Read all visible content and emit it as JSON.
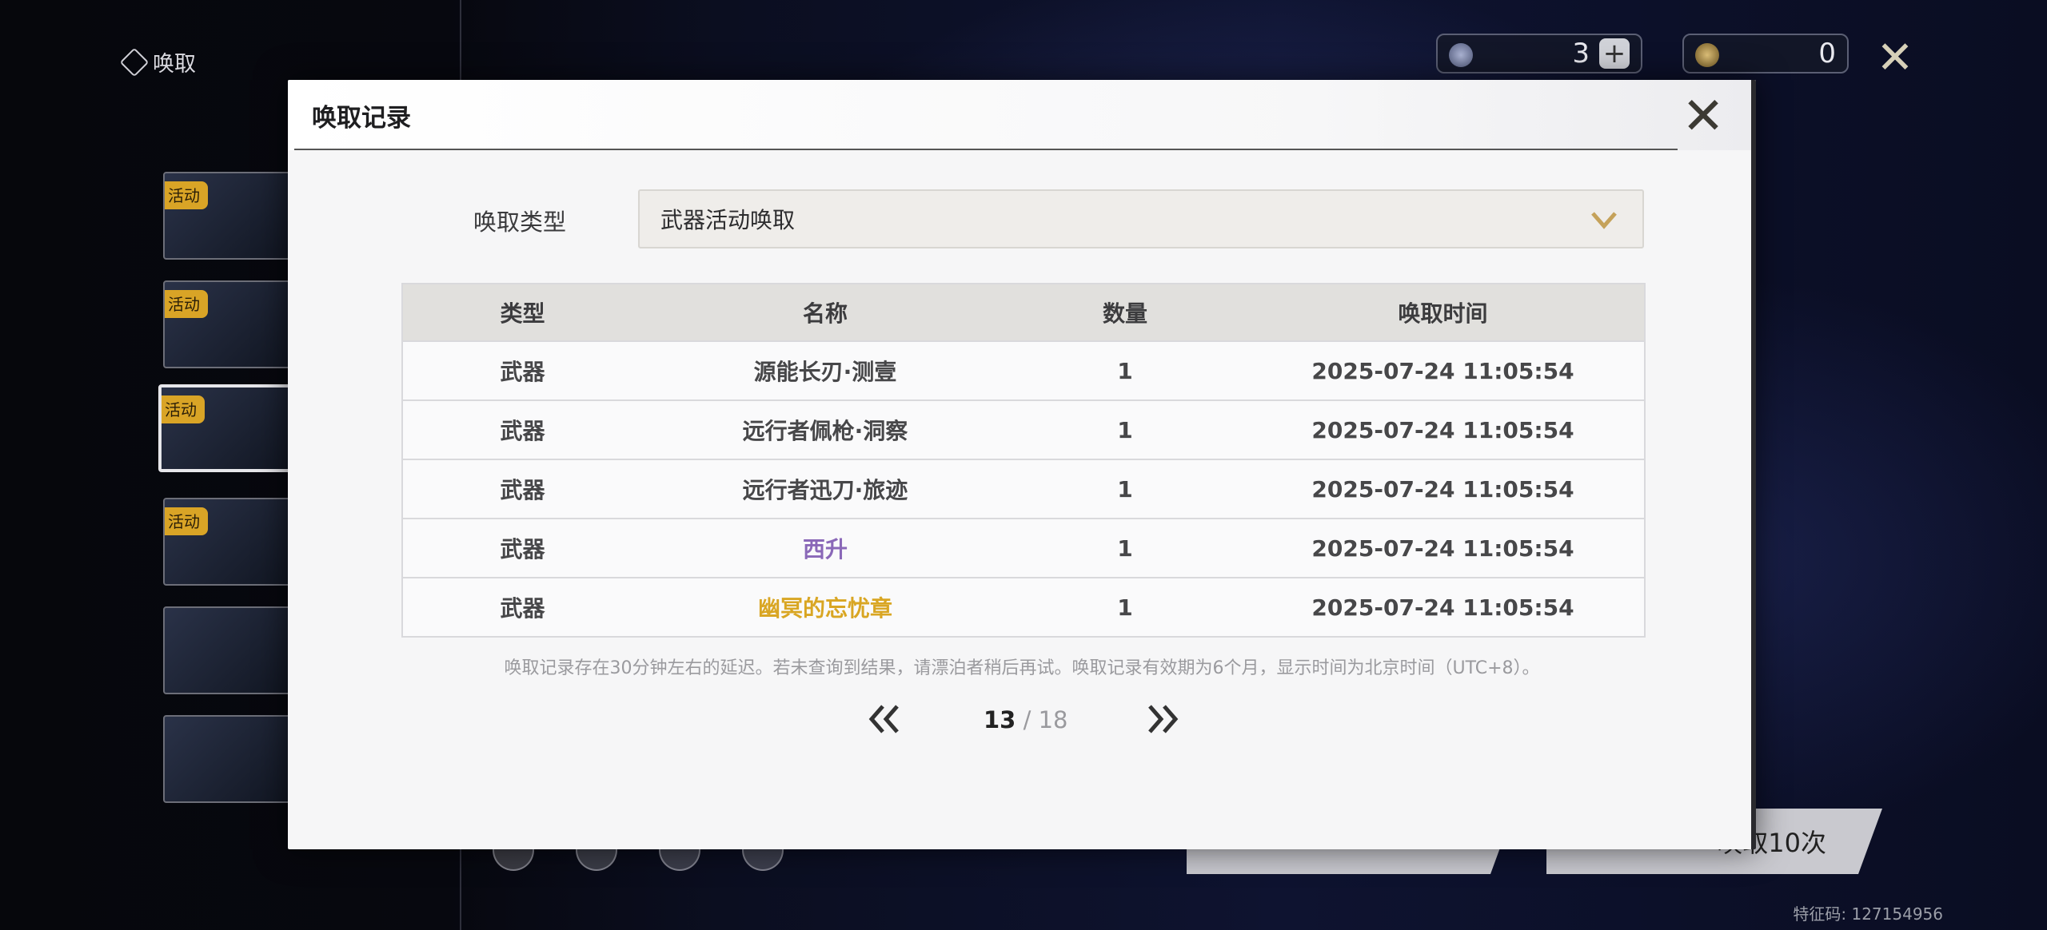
{
  "background": {
    "screen_title": "唤取",
    "banner_tag": "活动",
    "currency_1": {
      "amount": "3",
      "icon": "astrite-star-icon"
    },
    "currency_2": {
      "amount": "0",
      "icon": "tide-token-icon"
    },
    "pull_ten_label": "唤取10次",
    "feature_code": "特征码: 127154956"
  },
  "modal": {
    "title": "唤取记录",
    "type_label": "唤取类型",
    "type_selected": "武器活动唤取",
    "columns": [
      "类型",
      "名称",
      "数量",
      "唤取时间"
    ],
    "rows": [
      {
        "type": "武器",
        "name": "源能长刃·测壹",
        "qty": "1",
        "time": "2025-07-24 11:05:54"
      },
      {
        "type": "武器",
        "name": "远行者佩枪·洞察",
        "qty": "1",
        "time": "2025-07-24 11:05:54"
      },
      {
        "type": "武器",
        "name": "远行者迅刀·旅迹",
        "qty": "1",
        "time": "2025-07-24 11:05:54"
      },
      {
        "type": "武器",
        "name": "西升",
        "qty": "1",
        "time": "2025-07-24 11:05:54"
      },
      {
        "type": "武器",
        "name": "幽冥的忘忧章",
        "qty": "1",
        "time": "2025-07-24 11:05:54"
      }
    ],
    "notice": "唤取记录存在30分钟左右的延迟。若未查询到结果，请漂泊者稍后再试。唤取记录有效期为6个月，显示时间为北京时间（UTC+8）。",
    "pager": {
      "current": "13",
      "separator": " / ",
      "total": "18"
    },
    "colors": {
      "rarity_4": "#8a68b8",
      "rarity_5": "#d9a623",
      "accent": "#c5a25a"
    }
  }
}
